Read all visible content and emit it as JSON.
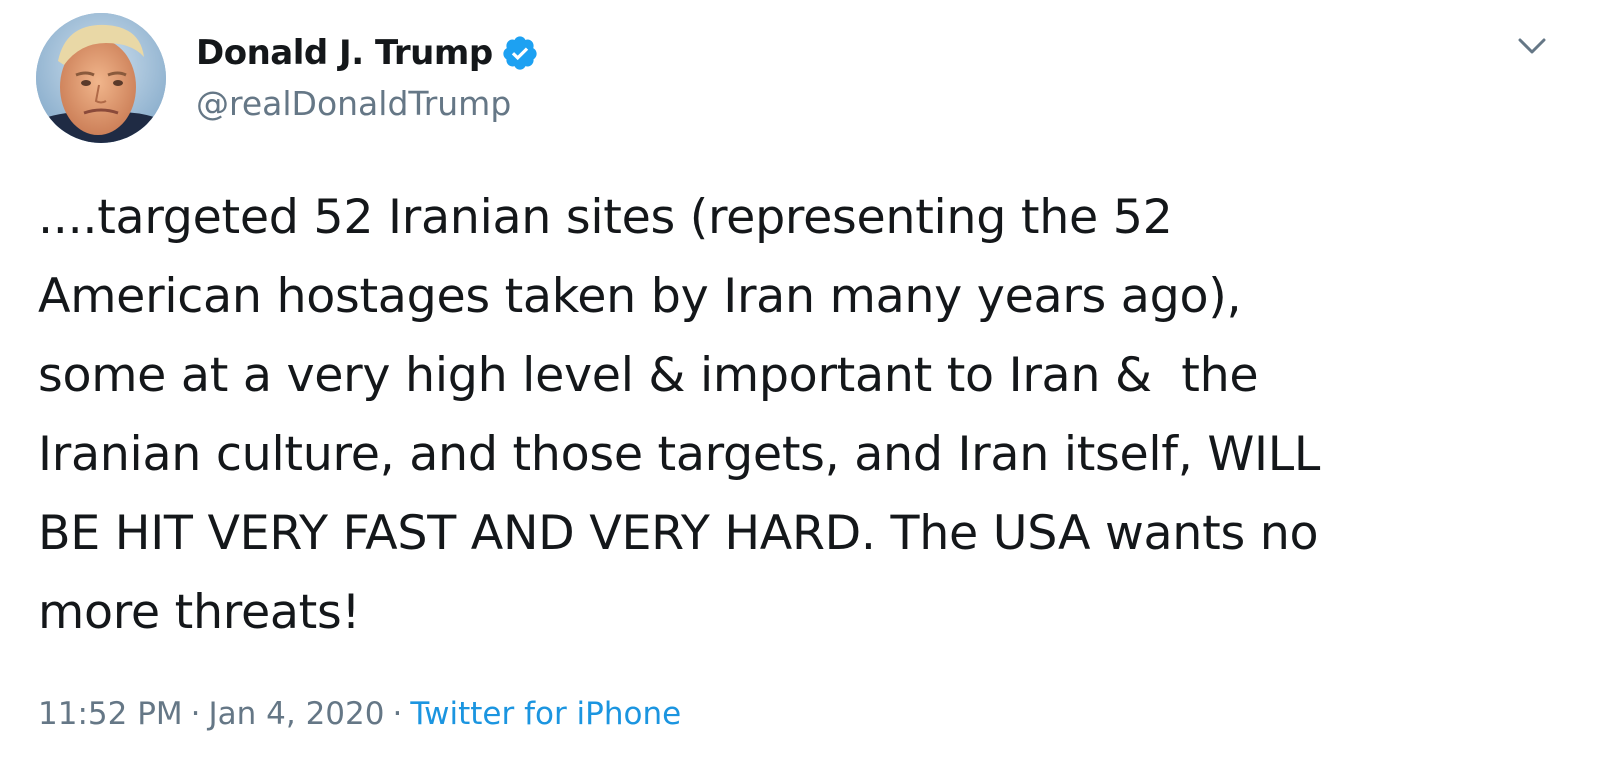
{
  "author": {
    "display_name": "Donald J. Trump",
    "handle": "@realDonaldTrump",
    "verified": true
  },
  "tweet": {
    "lines": [
      "....targeted 52 Iranian sites (representing the 52",
      "American hostages taken by Iran many years ago),",
      "some at a very high level & important to Iran &  the",
      "Iranian culture, and those targets, and Iran itself, WILL",
      "BE HIT VERY FAST AND VERY HARD. The USA wants no",
      "more threats!"
    ]
  },
  "meta": {
    "time": "11:52 PM",
    "separator": "·",
    "date": "Jan 4, 2020",
    "source": "Twitter for iPhone"
  },
  "icons": {
    "verified": "verified-badge-icon",
    "caret": "chevron-down-icon"
  },
  "colors": {
    "text_primary": "#14171a",
    "text_secondary": "#657786",
    "link": "#1b95e0",
    "verified_blue": "#1da1f2"
  }
}
